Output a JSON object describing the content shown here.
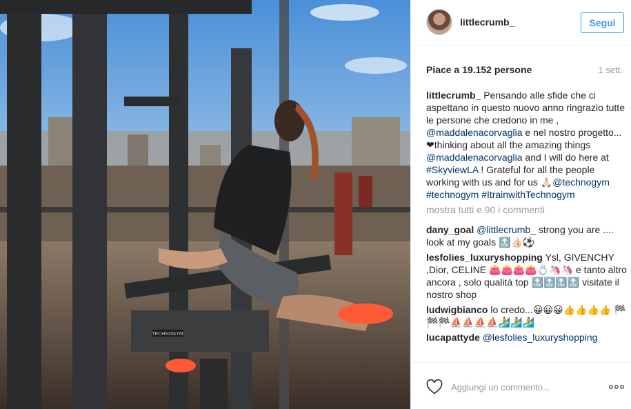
{
  "post": {
    "username": "littlecrumb_",
    "follow_label": "Segui",
    "likes_text": "Piace a 19.152 persone",
    "time_ago": "1 sett.",
    "caption": {
      "author": "littlecrumb_",
      "parts": [
        " Pensando alle sfide che ci aspettano in questo nuovo anno ringrazio tutte le persone che credono in me , ",
        "@maddalenacorvaglia",
        " e nel nostro progetto...❤thinking about all the amazing things ",
        "@maddalenacorvaglia",
        " and I will do here at ",
        "#SkyviewLA",
        " ! Grateful for all the people working with us and for us 🙏🏻",
        "@technogym",
        " ",
        "#technogym",
        " ",
        "#ItrainwithTechnogym"
      ]
    },
    "show_all_comments": "mostra tutti e 90 i commenti",
    "comments": [
      {
        "author": "dany_goal",
        "mention": "@littlecrumb_",
        "text": " strong you are .... look at my goals 🔝👍🏻⚽"
      },
      {
        "author": "lesfolies_luxuryshopping",
        "mention": "",
        "text": " Ysl, GIVENCHY ,Dior, CELINE 👛👛👛👛💍🦄🦄 e tanto altro ancora , solo qualità top 🔝🔝🔝🔝 visitate il nostro shop"
      },
      {
        "author": "ludwigbianco",
        "mention": "",
        "text": " lo credo...😀😀😀👍👍👍👍 🏁🏁🏁⛵⛵⛵⛵🏄🏄🏄"
      },
      {
        "author": "lucapattyde",
        "mention": "@lesfolies_luxuryshopping",
        "text": ""
      }
    ],
    "add_comment_placeholder": "Aggiungi un commento...",
    "icons": {
      "like": "heart-icon",
      "more": "more-options-icon"
    },
    "colors": {
      "accent": "#3897f0",
      "link": "#003569",
      "muted": "#999999"
    }
  }
}
